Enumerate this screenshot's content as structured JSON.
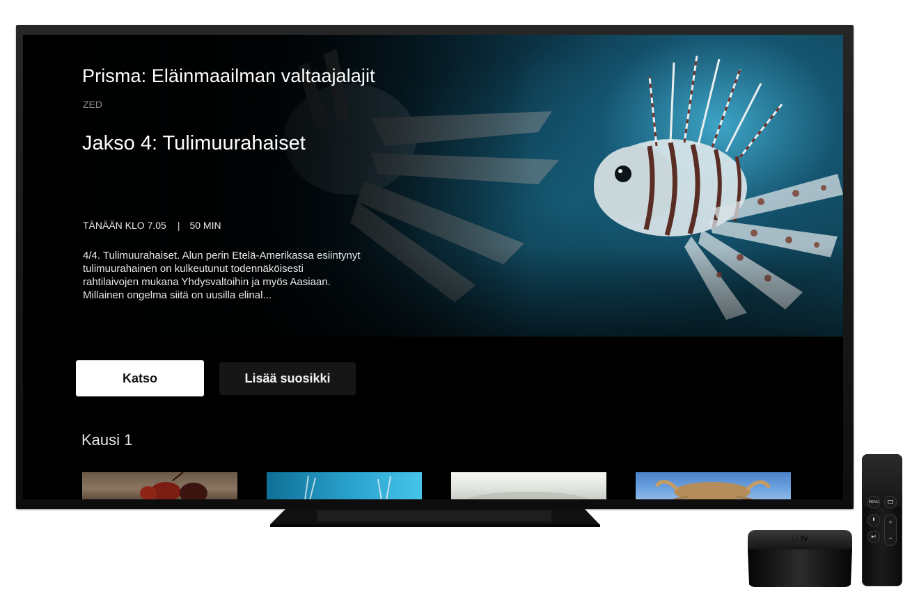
{
  "show": {
    "title": "Prisma: Eläinmaailman valtaajalajit",
    "channel": "ZED",
    "episode_title": "Jakso 4: Tulimuurahaiset",
    "airtime": "TÄNÄÄN KLO 7.05",
    "separator": "|",
    "duration": "50 MIN",
    "description": "4/4. Tulimuurahaiset. Alun perin Etelä-Amerikassa esiintynyt tulimuurahainen on kulkeutunut todennäköisesti rahtilaivojen mukana Yhdysvaltoihin ja myös Aasiaan. Millainen ongelma siitä on uusilla elinal..."
  },
  "actions": {
    "watch_label": "Katso",
    "favorite_label": "Lisää suosikki"
  },
  "season": {
    "label": "Kausi 1",
    "episode_thumbnails": [
      {
        "subject": "fire-ant"
      },
      {
        "subject": "lionfish"
      },
      {
        "subject": "misty-landscape"
      },
      {
        "subject": "crab"
      }
    ]
  },
  "remote": {
    "menu_label": "MENU",
    "vol_up": "+",
    "vol_down": "−",
    "play_pause": "▶II"
  },
  "colors": {
    "primary_button_bg": "#ffffff",
    "secondary_button_bg": "#161616",
    "screen_bg": "#000000",
    "ocean_accent": "#2aa3cf"
  }
}
